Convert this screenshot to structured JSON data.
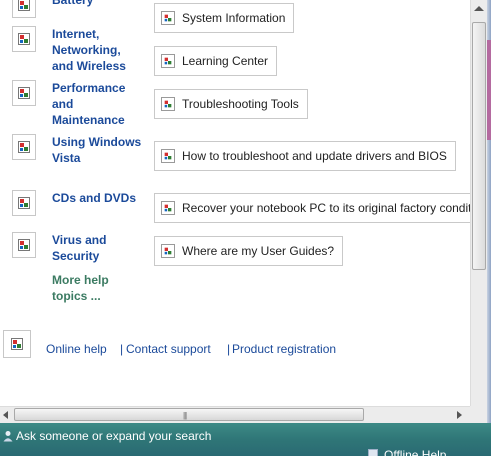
{
  "categories": [
    {
      "label": "Battery"
    },
    {
      "label": "Internet, Networking, and Wireless"
    },
    {
      "label": "Performance and Maintenance"
    },
    {
      "label": "Using Windows Vista"
    },
    {
      "label": "CDs and DVDs"
    },
    {
      "label": "Virus and Security"
    }
  ],
  "more_help": "More help topics ...",
  "tools": [
    {
      "label": "System Information"
    },
    {
      "label": "Learning Center"
    },
    {
      "label": "Troubleshooting Tools"
    },
    {
      "label": "How to troubleshoot and update drivers and BIOS"
    },
    {
      "label": "Recover your notebook PC to its original factory condition"
    },
    {
      "label": "Where are my User Guides?"
    }
  ],
  "footer": {
    "online_help": "Online help",
    "sep1": "|",
    "contact_support": "Contact support",
    "sep2": "|",
    "product_registration": "Product registration"
  },
  "bottom_bar": {
    "search_text": "Ask someone or expand your search",
    "offline_text": "Offline Help"
  },
  "colors": {
    "link_blue": "#1b4a9a",
    "more_help_green": "#3b7b62",
    "bottom_bar": "#2f7677"
  }
}
